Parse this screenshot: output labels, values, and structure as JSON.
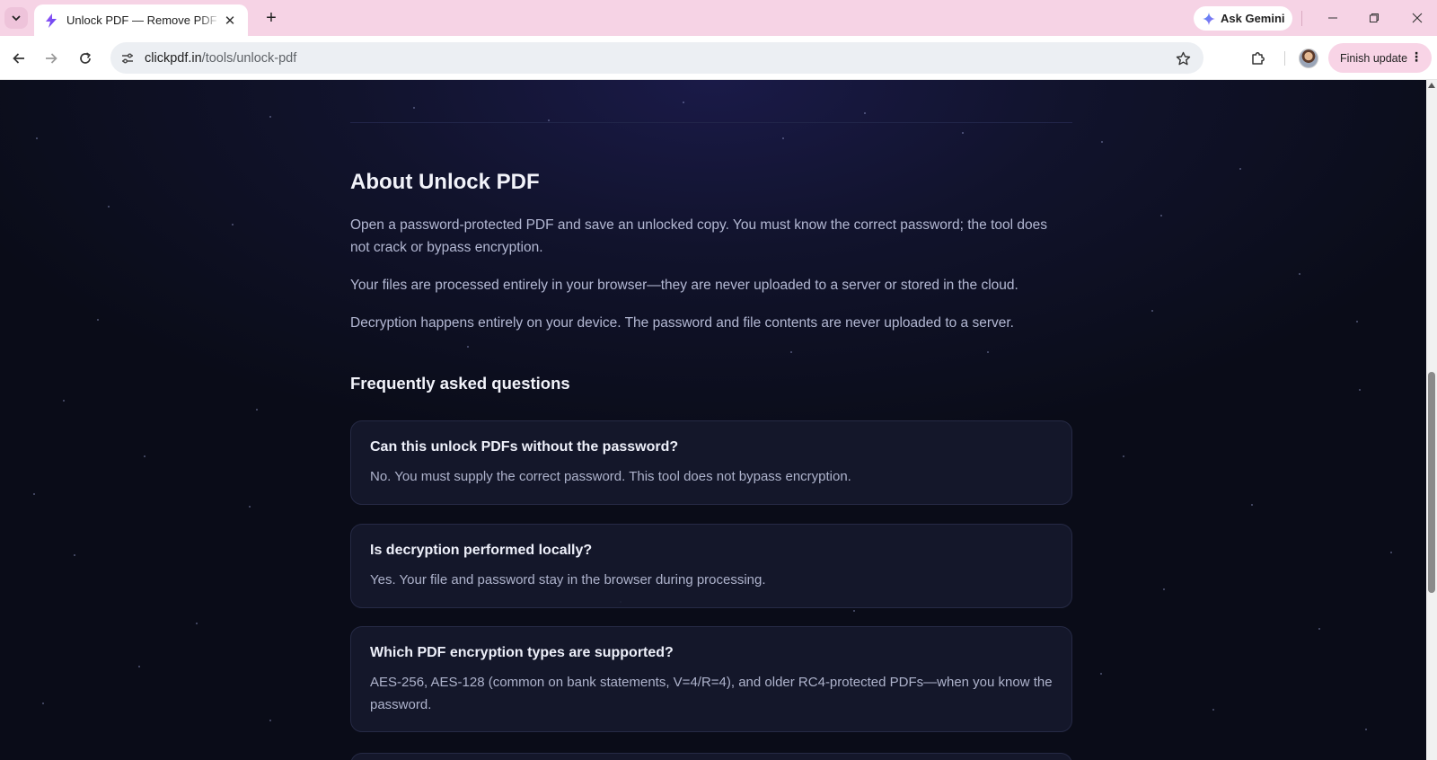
{
  "browser": {
    "tab_title": "Unlock PDF — Remove PDF Password",
    "ask_gemini_label": "Ask Gemini",
    "url_host": "clickpdf.in",
    "url_path": "/tools/unlock-pdf",
    "finish_update_label": "Finish update",
    "colors": {
      "tabstrip": "#f6d3e5",
      "update_button": "#f8d4e6"
    }
  },
  "page": {
    "about_title": "About Unlock PDF",
    "paragraphs": [
      "Open a password-protected PDF and save an unlocked copy. You must know the correct password; the tool does not crack or bypass encryption.",
      "Your files are processed entirely in your browser—they are never uploaded to a server or stored in the cloud.",
      "Decryption happens entirely on your device. The password and file contents are never uploaded to a server."
    ],
    "faq_title": "Frequently asked questions",
    "faqs": [
      {
        "q": "Can this unlock PDFs without the password?",
        "a": "No. You must supply the correct password. This tool does not bypass encryption."
      },
      {
        "q": "Is decryption performed locally?",
        "a": "Yes. Your file and password stay in the browser during processing."
      },
      {
        "q": "Which PDF encryption types are supported?",
        "a": "AES-256, AES-128 (common on bank statements, V=4/R=4), and older RC4-protected PDFs—when you know the password."
      }
    ],
    "colors": {
      "background": "#0b0d1a",
      "heading": "#f2f3fa",
      "body_text": "#b3b8d3",
      "card": "#16192c"
    }
  }
}
